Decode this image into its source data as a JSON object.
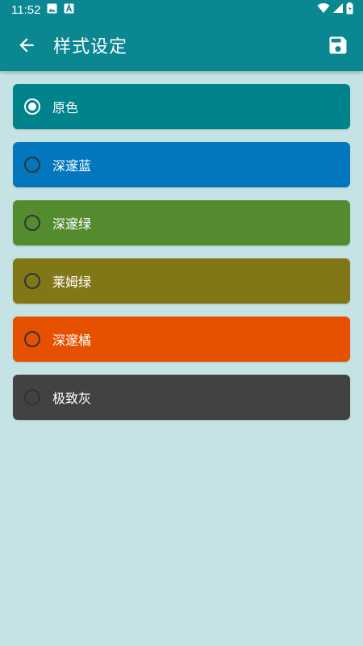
{
  "status_bar": {
    "time": "11:52",
    "icons": [
      "image-icon",
      "a-notification-icon",
      "wifi-icon",
      "signal-icon",
      "battery-icon"
    ]
  },
  "app_bar": {
    "title": "样式设定",
    "back_icon": "arrow-back-icon",
    "save_icon": "save-icon"
  },
  "colors": {
    "header": "#0a8790",
    "background": "#c5e3e4"
  },
  "options": [
    {
      "label": "原色",
      "color": "#00838a",
      "selected": true
    },
    {
      "label": "深邃蓝",
      "color": "#0277bd",
      "selected": false
    },
    {
      "label": "深邃绿",
      "color": "#558b2f",
      "selected": false
    },
    {
      "label": "莱姆绿",
      "color": "#827717",
      "selected": false
    },
    {
      "label": "深邃橘",
      "color": "#e65100",
      "selected": false
    },
    {
      "label": "极致灰",
      "color": "#424242",
      "selected": false
    }
  ]
}
